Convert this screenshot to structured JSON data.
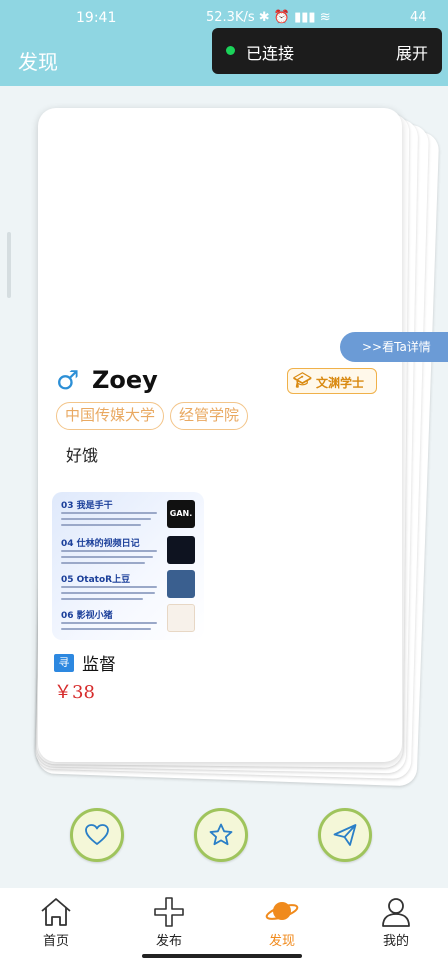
{
  "status_bar": {
    "time": "19:41",
    "network": "52.3K/s",
    "battery": "44"
  },
  "header": {
    "title": "发现"
  },
  "connection": {
    "label": "已连接",
    "expand_label": "展开"
  },
  "card": {
    "detail_label": ">>看Ta详情",
    "gender_symbol": "♂",
    "name": "Zoey",
    "degree_badge": "文渊学士",
    "tags": [
      "中国传媒大学",
      "经管学院"
    ],
    "bio": "好饿",
    "thumbnail_rows": [
      {
        "heading": "03 我是手干"
      },
      {
        "heading": "04 仕林的视频日记"
      },
      {
        "heading": "05 OtatoR上豆"
      },
      {
        "heading": "06 影视小猪"
      }
    ],
    "thumbnail_logo_text": "GAN.",
    "service_icon_text": "寻",
    "service_title": "监督",
    "price": "￥38"
  },
  "actions": {
    "like": "heart-icon",
    "favorite": "star-icon",
    "send": "paper-plane-icon"
  },
  "bottom_nav": {
    "items": [
      {
        "label": "首页",
        "icon": "home-icon"
      },
      {
        "label": "发布",
        "icon": "plus-icon"
      },
      {
        "label": "发现",
        "icon": "planet-icon",
        "active": true
      },
      {
        "label": "我的",
        "icon": "profile-icon"
      }
    ],
    "active_color": "#f08a1c"
  },
  "colors": {
    "header": "#8fd6e2",
    "accent_blue": "#6b9bd6",
    "tag": "#e9a962",
    "price": "#d62b2b"
  }
}
